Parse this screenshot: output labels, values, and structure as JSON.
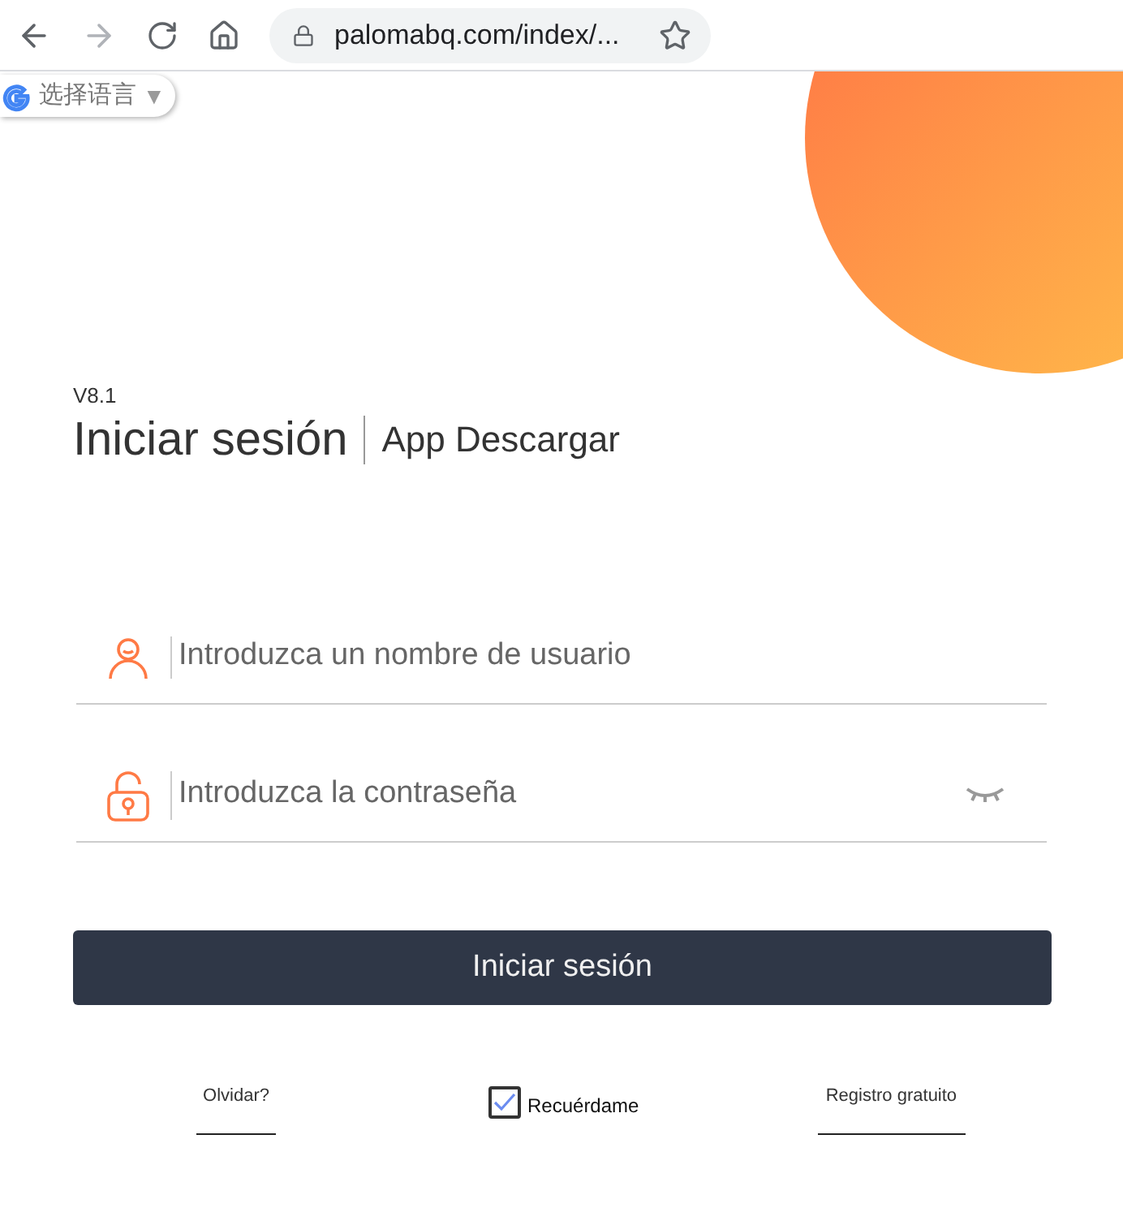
{
  "browser": {
    "url": "palomabq.com/index/..."
  },
  "translate": {
    "label": "选择语言",
    "caret": "▼"
  },
  "version": "V8.1",
  "title": "Iniciar sesión",
  "app_link": "App Descargar",
  "username": {
    "placeholder": "Introduzca un nombre de usuario"
  },
  "password": {
    "placeholder": "Introduzca la contraseña"
  },
  "submit": "Iniciar sesión",
  "forgot": "Olvidar?",
  "remember": {
    "label": "Recuérdame",
    "checked": true
  },
  "register": "Registro gratuito"
}
